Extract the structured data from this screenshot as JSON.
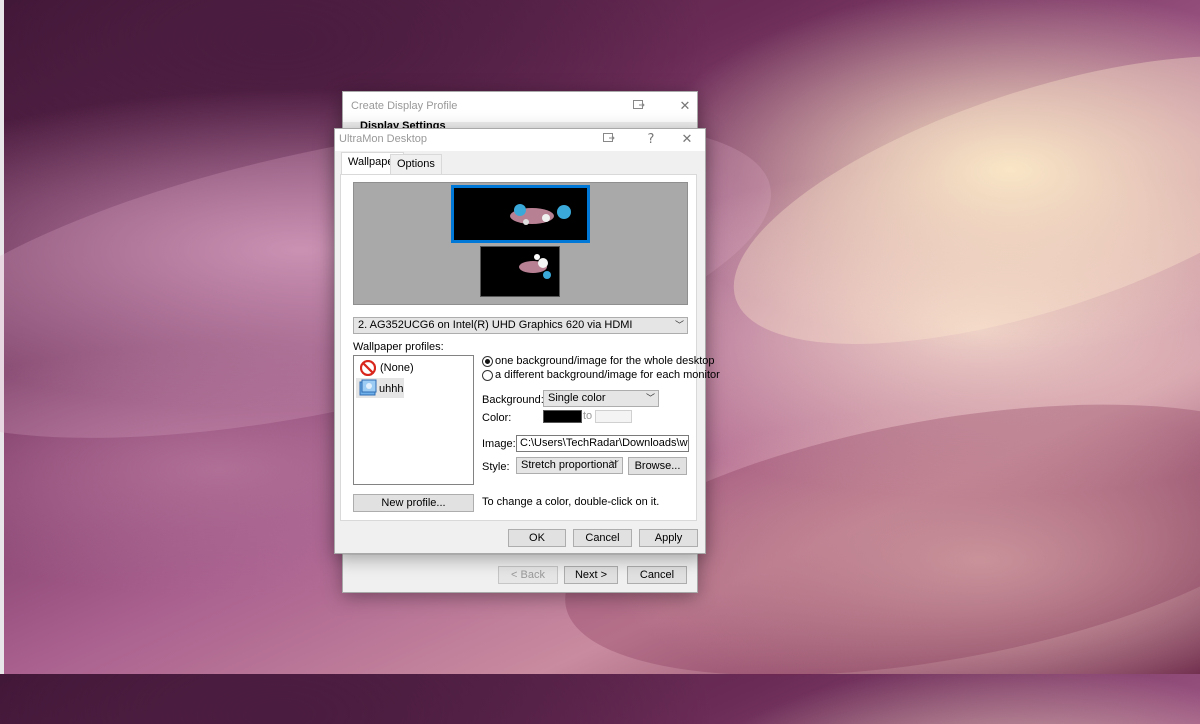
{
  "back_window": {
    "title": "Create Display Profile",
    "section_heading": "Display Settings",
    "back_label": "< Back",
    "next_label": "Next >",
    "cancel_label": "Cancel"
  },
  "dialog": {
    "title": "UltraMon Desktop",
    "help_glyph": "?",
    "close_glyph": "✕",
    "tabs": [
      {
        "label": "Wallpaper",
        "active": true
      },
      {
        "label": "Options",
        "active": false
      }
    ],
    "monitor_select": "2. AG352UCG6 on Intel(R) UHD Graphics 620 via HDMI",
    "profiles_label": "Wallpaper profiles:",
    "profiles": [
      {
        "label": "(None)",
        "icon": "no-entry-icon"
      },
      {
        "label": "uhhh",
        "icon": "wallpaper-profile-icon"
      }
    ],
    "mode_options": [
      {
        "label": "one background/image for the whole desktop",
        "selected": true
      },
      {
        "label": "a different background/image for each monitor",
        "selected": false
      }
    ],
    "background_label": "Background:",
    "background_value": "Single color",
    "color_label": "Color:",
    "color_to": "to",
    "color_primary": "#000000",
    "image_label": "Image:",
    "image_value": "C:\\Users\\TechRadar\\Downloads\\wallpaper",
    "style_label": "Style:",
    "style_value": "Stretch proportional",
    "browse_label": "Browse...",
    "new_profile_label": "New profile...",
    "hint": "To change a color, double-click on it.",
    "ok_label": "OK",
    "cancel_label": "Cancel",
    "apply_label": "Apply",
    "selection_color": "#0078d7"
  }
}
